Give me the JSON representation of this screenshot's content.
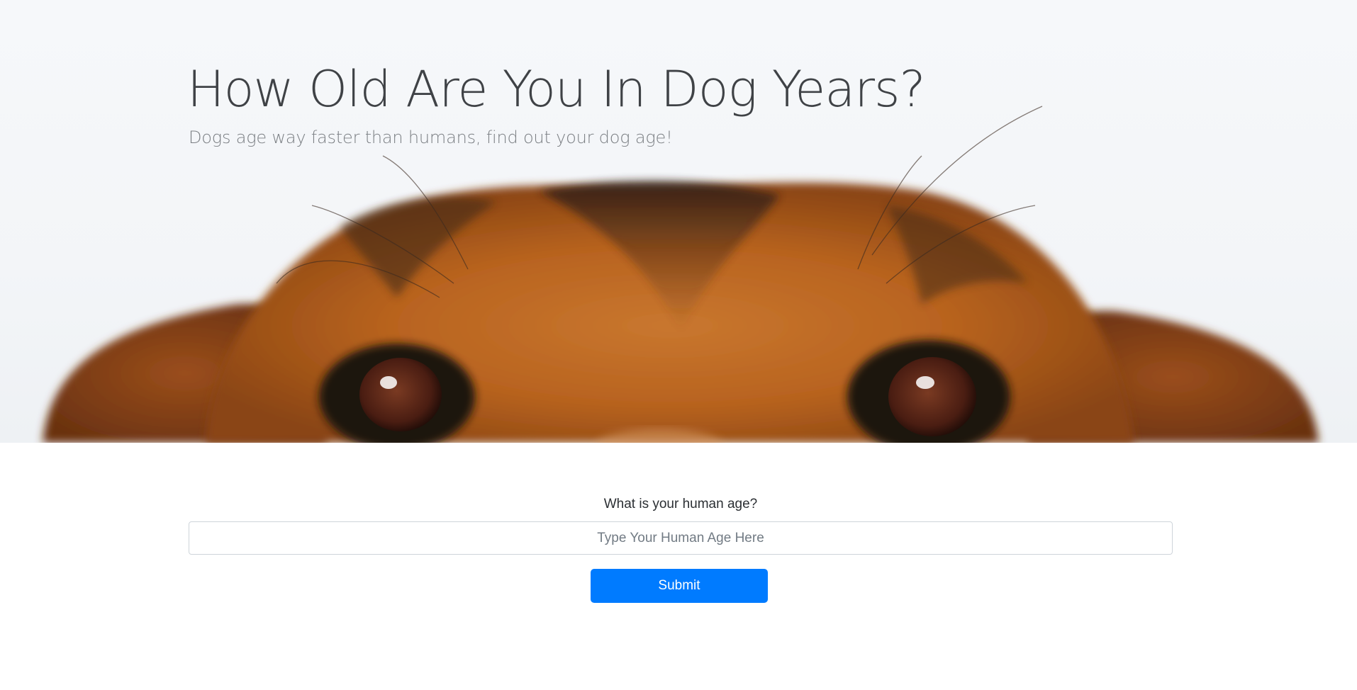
{
  "hero": {
    "title": "How Old Are You In Dog Years?",
    "subtitle": "Dogs age way faster than humans, find out your dog age!",
    "image": "dog-face-peeking-photo"
  },
  "form": {
    "label": "What is your human age?",
    "input_placeholder": "Type Your Human Age Here",
    "input_value": "",
    "submit_label": "Submit"
  },
  "colors": {
    "primary": "#007bff",
    "hero_background": "#f4f6f9",
    "title_text": "#3f4246",
    "subtitle_text": "#7b7f84"
  }
}
